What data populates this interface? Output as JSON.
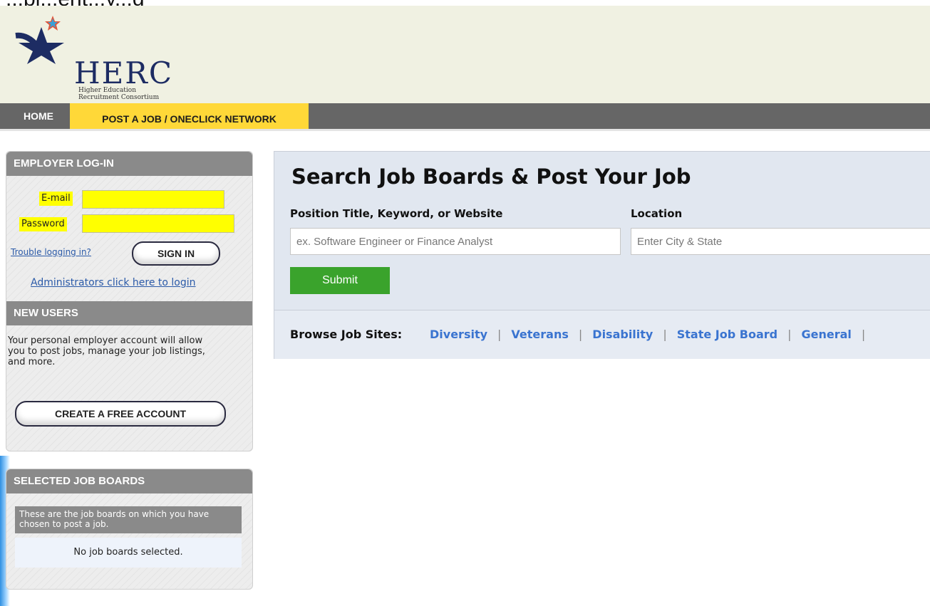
{
  "top_cut_text": "...pl...ent...y...g",
  "header": {
    "logo_name": "HERC",
    "logo_sub_line1": "Higher Education",
    "logo_sub_line2": "Recruitment Consortium"
  },
  "nav": {
    "home": "HOME",
    "post_job": "POST A JOB / ONECLICK NETWORK"
  },
  "login": {
    "heading": "EMPLOYER LOG-IN",
    "email_label": "E-mail",
    "password_label": "Password",
    "trouble_link": "Trouble logging in?",
    "signin_button": "SIGN IN",
    "admin_link": "Administrators click here to login"
  },
  "new_users": {
    "heading": "NEW USERS",
    "text": "Your personal employer account will allow you to post jobs, manage your job listings, and more.",
    "create_button": "CREATE A FREE ACCOUNT"
  },
  "selected_boards": {
    "heading": "SELECTED JOB BOARDS",
    "note": "These are the job boards on which you have chosen to post a job.",
    "empty": "No job boards selected."
  },
  "search": {
    "title": "Search Job Boards & Post Your Job",
    "keyword_label": "Position Title, Keyword, or Website",
    "keyword_placeholder": "ex. Software Engineer or Finance Analyst",
    "location_label": "Location",
    "location_placeholder": "Enter City & State",
    "submit": "Submit"
  },
  "browse": {
    "label": "Browse Job Sites:",
    "links": [
      "Diversity",
      "Veterans",
      "Disability",
      "State Job Board",
      "General"
    ]
  },
  "colors": {
    "nav_bg": "#666666",
    "nav_active": "#ffd838",
    "highlight": "#ffff00",
    "submit_green": "#3aa32c",
    "link_blue": "#3a74d0"
  }
}
